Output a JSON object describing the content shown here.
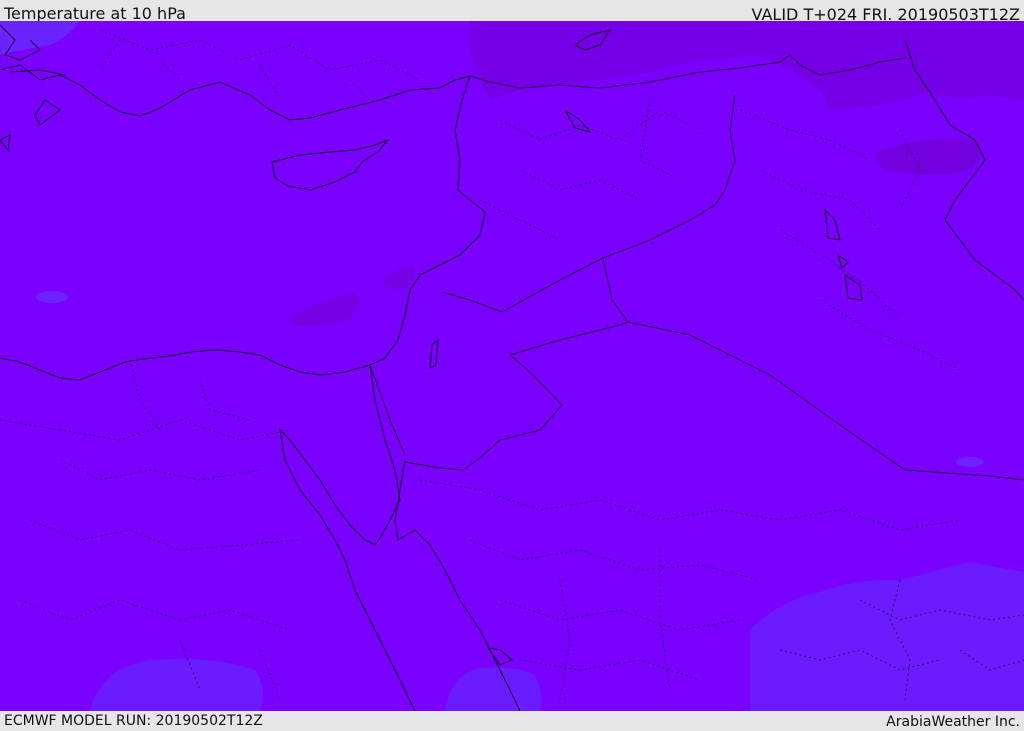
{
  "header": {
    "title": "Temperature at 10 hPa",
    "valid": "VALID T+024 FRI. 20190503T12Z"
  },
  "footer": {
    "model_run": "ECMWF MODEL RUN: 20190502T12Z",
    "credit": "ArabiaWeather Inc."
  },
  "colors": {
    "base_field": "#7a00ff",
    "warmer_field": "#7500e8",
    "cooler_field": "#6a1cff",
    "coastline": "#1a0a2a",
    "border": "#2a1040"
  }
}
